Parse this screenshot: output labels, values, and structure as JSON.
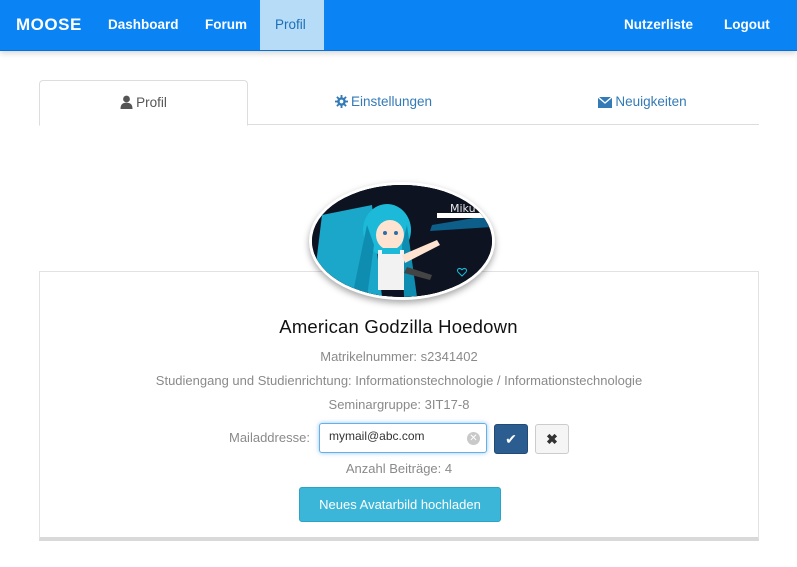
{
  "nav": {
    "brand": "MOOSE",
    "items": [
      {
        "label": "Dashboard"
      },
      {
        "label": "Forum"
      },
      {
        "label": "Profil",
        "active": true
      }
    ],
    "right": [
      {
        "label": "Nutzerliste"
      },
      {
        "label": "Logout"
      }
    ]
  },
  "tabs": [
    {
      "label": "Profil",
      "icon": "user-icon",
      "active": true
    },
    {
      "label": "Einstellungen",
      "icon": "gear-icon"
    },
    {
      "label": "Neuigkeiten",
      "icon": "envelope-icon"
    }
  ],
  "avatar": {
    "caption": "Miku"
  },
  "profile": {
    "name": "American Godzilla Hoedown",
    "matrikel": "Matrikelnummer: s2341402",
    "studiengang": "Studiengang und Studienrichtung: Informationstechnologie / Informationstechnologie",
    "seminargruppe": "Seminargruppe: 3IT17-8",
    "mail_label": "Mailaddresse:",
    "mail_value": "mymail@abc.com",
    "beitraege": "Anzahl Beiträge: 4",
    "upload_label": "Neues Avatarbild hochladen"
  },
  "colors": {
    "navbar": "#0a84f5",
    "active_nav": "#b7dcf7",
    "ok_button": "#2b5d91",
    "upload_button": "#3bb6d8"
  }
}
